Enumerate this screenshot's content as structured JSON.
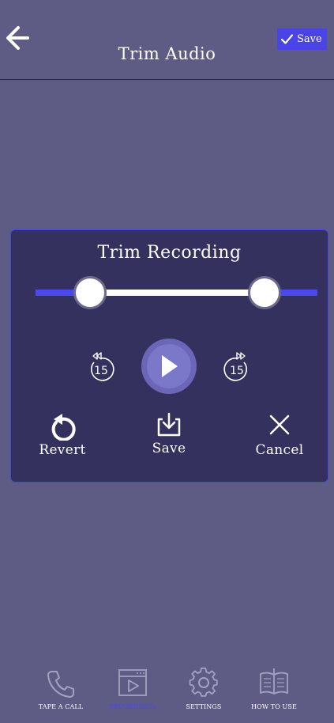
{
  "header": {
    "title": "Trim Audio",
    "save_label": "Save"
  },
  "trim_panel": {
    "title": "Trim Recording",
    "selection_start": 0.19,
    "selection_end": 0.81,
    "rewind_seconds": "15",
    "forward_seconds": "15",
    "actions": {
      "revert": "Revert",
      "save": "Save",
      "cancel": "Cancel"
    }
  },
  "bottom_nav": {
    "items": [
      {
        "label": "TAPE A CALL",
        "icon": "phone-icon",
        "active": false
      },
      {
        "label": "RECORDINGS",
        "icon": "recordings-icon",
        "active": true
      },
      {
        "label": "SETTINGS",
        "icon": "gear-icon",
        "active": false
      },
      {
        "label": "HOW TO USE",
        "icon": "book-icon",
        "active": false
      }
    ]
  },
  "colors": {
    "background": "#5e5b85",
    "panel": "#34315f",
    "accent": "#4a44e6",
    "text": "#ffffff"
  }
}
